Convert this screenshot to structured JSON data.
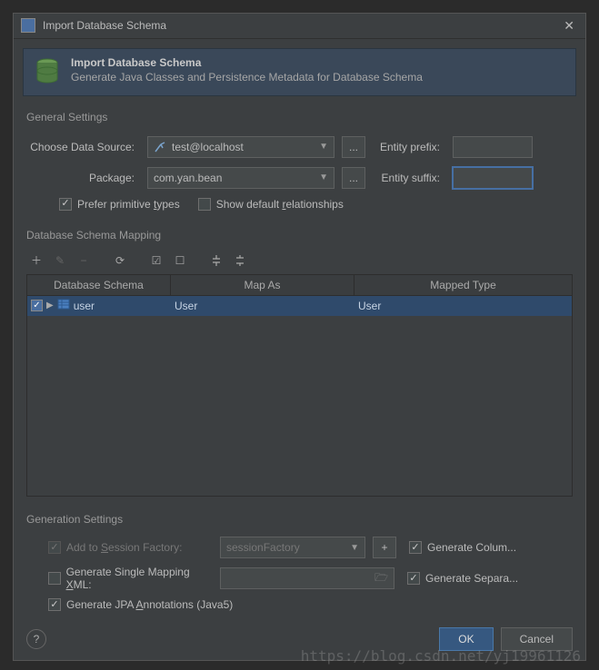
{
  "window": {
    "title": "Import Database Schema"
  },
  "banner": {
    "title": "Import Database Schema",
    "desc": "Generate Java Classes and Persistence Metadata for Database Schema"
  },
  "general": {
    "section_label": "General Settings",
    "data_source_label": "Choose Data Source:",
    "data_source_value": "test@localhost",
    "package_label": "Package:",
    "package_value": "com.yan.bean",
    "entity_prefix_label": "Entity prefix:",
    "entity_prefix_value": "",
    "entity_suffix_label": "Entity suffix:",
    "entity_suffix_value": "",
    "prefer_primitive_pre": "Prefer primitive ",
    "prefer_primitive_u": "t",
    "prefer_primitive_post": "ypes",
    "show_rel_pre": "Show default ",
    "show_rel_u": "r",
    "show_rel_post": "elationships",
    "ellipsis": "..."
  },
  "mapping": {
    "section_label": "Database Schema Mapping",
    "cols": {
      "c1": "Database Schema",
      "c2": "Map As",
      "c3": "Mapped Type"
    },
    "rows": [
      {
        "name": "user",
        "map_as": "User",
        "mapped_type": "User"
      }
    ]
  },
  "generation": {
    "section_label": "Generation Settings",
    "add_session_pre": "Add to ",
    "add_session_u": "S",
    "add_session_post": "ession Factory:",
    "session_value": "sessionFactory",
    "gen_column_label": "Generate Colum...",
    "single_xml_pre": "Generate Single Mapping ",
    "single_xml_u": "X",
    "single_xml_post": "ML:",
    "single_xml_value": "",
    "gen_separate_label": "Generate Separa...",
    "jpa_pre": "Generate JPA ",
    "jpa_u": "A",
    "jpa_post": "nnotations (Java5)",
    "plus": "+"
  },
  "footer": {
    "ok": "OK",
    "cancel": "Cancel",
    "help": "?"
  },
  "watermark": "https://blog.csdn.net/yj19961126"
}
